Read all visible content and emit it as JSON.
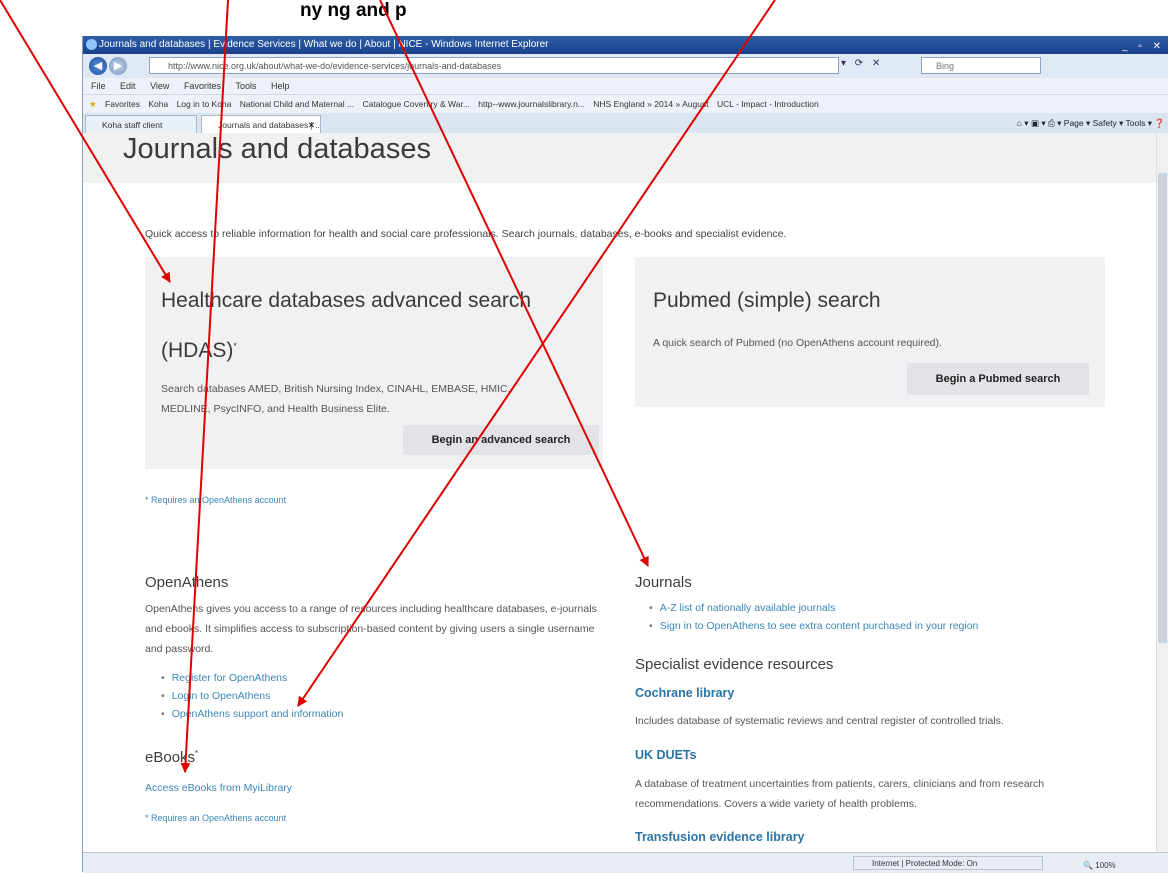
{
  "caption": "ny                              ng and p",
  "browser": {
    "title": "Journals and databases | Evidence Services | What we do | About | NICE - Windows Internet Explorer",
    "address": "http://www.nice.org.uk/about/what-we-do/evidence-services/journals-and-databases",
    "search_placeholder": "Bing",
    "menu": [
      "File",
      "Edit",
      "View",
      "Favorites",
      "Tools",
      "Help"
    ],
    "favorites": [
      "Favorites",
      "Koha",
      "Log in to Koha",
      "National Child and Maternal ...",
      "Catalogue  Coventry & War...",
      "http--www.journalslibrary.n...",
      "NHS England » 2014 » August",
      "UCL - Impact - Introduction"
    ],
    "tabs": [
      {
        "label": "Koha staff client"
      },
      {
        "label": "Journals and databases | ..."
      }
    ],
    "command_bar": "Page ▾   Safety ▾   Tools ▾",
    "status_zone": "Internet | Protected Mode: On",
    "zoom": "100%"
  },
  "page": {
    "title": "Journals and databases",
    "intro": "Quick access to reliable information for health and social care professionals. Search journals, databases, e-books and specialist evidence.",
    "hdas": {
      "title_line1": "Healthcare databases advanced search",
      "title_line2": "(HDAS)",
      "title_sup": "*",
      "description": "Search databases AMED, British Nursing Index, CINAHL, EMBASE, HMIC, MEDLINE, PsycINFO, and Health Business Elite.",
      "button": "Begin an advanced search"
    },
    "pubmed": {
      "title": "Pubmed (simple) search",
      "description": "A quick search of Pubmed (no OpenAthens account required).",
      "button": "Begin a Pubmed search"
    },
    "requires_note": "* Requires an OpenAthens account",
    "openathens": {
      "heading": "OpenAthens",
      "text": "OpenAthens gives you access to a range of resources including healthcare databases, e-journals and ebooks. It simplifies access to subscription-based content by giving users a single username and password.",
      "links": [
        "Register for OpenAthens",
        "Login to OpenAthens",
        "OpenAthens support and information"
      ]
    },
    "ebooks": {
      "heading": "eBooks",
      "heading_sup": "*",
      "link": "Access eBooks from MyiLibrary",
      "note": "* Requires an OpenAthens account"
    },
    "journals": {
      "heading": "Journals",
      "links": [
        "A-Z list of nationally available journals",
        "Sign in to OpenAthens to see extra content purchased in your region"
      ]
    },
    "specialist": {
      "heading": "Specialist evidence resources",
      "cochrane_title": "Cochrane library",
      "cochrane_text": "Includes database of systematic reviews and central register of controlled trials.",
      "ukduets_title": "UK DUETs",
      "ukduets_text": "A database of treatment uncertainties from patients, carers, clinicians and from research recommendations. Covers a wide variety of health problems.",
      "transfusion_title": "Transfusion evidence library"
    }
  },
  "annotation": {
    "arrow_color": "#e00000"
  }
}
